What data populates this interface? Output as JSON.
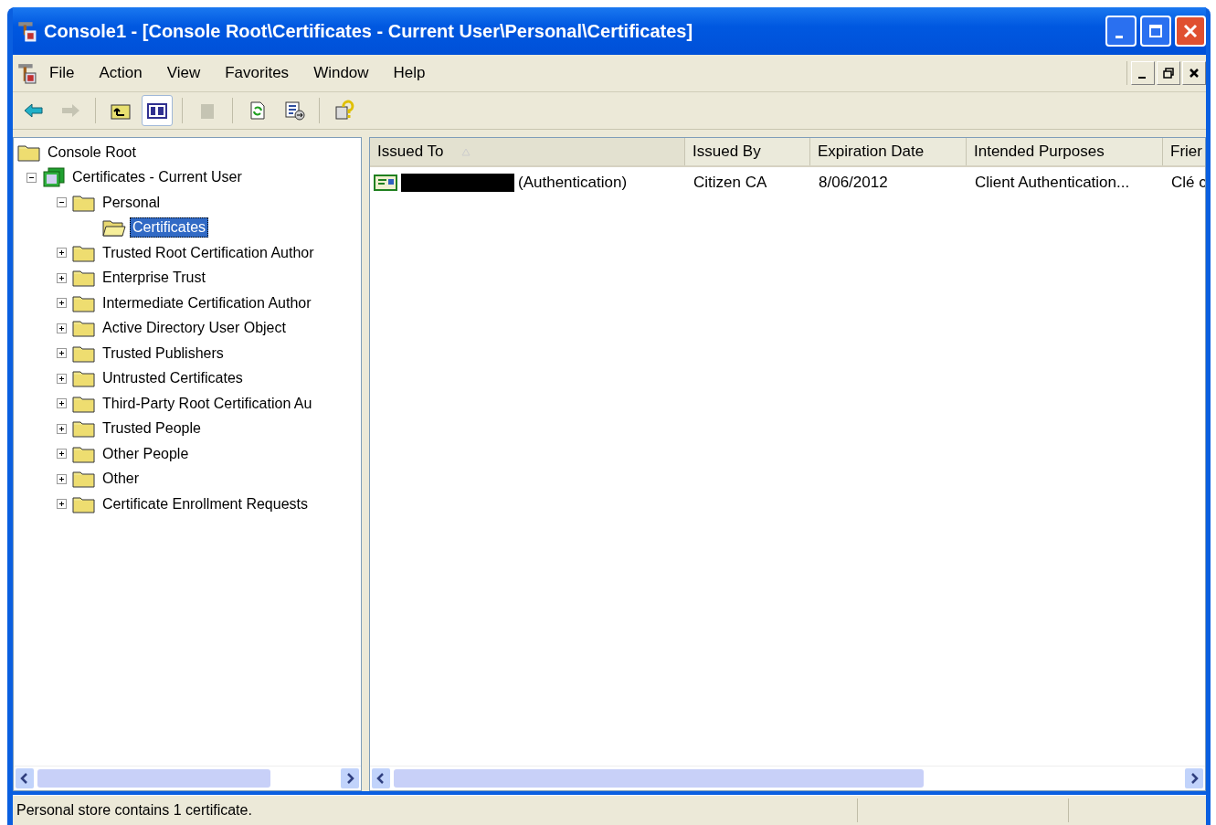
{
  "window": {
    "title": "Console1 - [Console Root\\Certificates - Current User\\Personal\\Certificates]"
  },
  "menu": [
    "File",
    "Action",
    "View",
    "Favorites",
    "Window",
    "Help"
  ],
  "toolbar": [
    {
      "kind": "back",
      "disabled": false,
      "pressed": false
    },
    {
      "kind": "forward",
      "disabled": true,
      "pressed": false
    },
    {
      "kind": "sep"
    },
    {
      "kind": "up",
      "disabled": false,
      "pressed": false
    },
    {
      "kind": "tree",
      "disabled": false,
      "pressed": true
    },
    {
      "kind": "sep"
    },
    {
      "kind": "delete",
      "disabled": true,
      "pressed": false
    },
    {
      "kind": "sep"
    },
    {
      "kind": "refresh",
      "disabled": false,
      "pressed": false
    },
    {
      "kind": "export",
      "disabled": false,
      "pressed": false
    },
    {
      "kind": "sep"
    },
    {
      "kind": "help",
      "disabled": false,
      "pressed": false
    }
  ],
  "tree": [
    {
      "label": "Console Root",
      "kind": "folder",
      "selected": false,
      "children": [
        {
          "label": "Certificates - Current User",
          "kind": "snapin",
          "expanded": true,
          "selected": false,
          "children": [
            {
              "label": "Personal",
              "kind": "folder",
              "expanded": true,
              "selected": false,
              "children": [
                {
                  "label": "Certificates",
                  "kind": "open",
                  "selected": true
                }
              ]
            },
            {
              "label": "Trusted Root Certification Author",
              "kind": "folder",
              "expanded": false,
              "selected": false
            },
            {
              "label": "Enterprise Trust",
              "kind": "folder",
              "expanded": false,
              "selected": false
            },
            {
              "label": "Intermediate Certification Author",
              "kind": "folder",
              "expanded": false,
              "selected": false
            },
            {
              "label": "Active Directory User Object",
              "kind": "folder",
              "expanded": false,
              "selected": false
            },
            {
              "label": "Trusted Publishers",
              "kind": "folder",
              "expanded": false,
              "selected": false
            },
            {
              "label": "Untrusted Certificates",
              "kind": "folder",
              "expanded": false,
              "selected": false
            },
            {
              "label": "Third-Party Root Certification Au",
              "kind": "folder",
              "expanded": false,
              "selected": false
            },
            {
              "label": "Trusted People",
              "kind": "folder",
              "expanded": false,
              "selected": false
            },
            {
              "label": "Other People",
              "kind": "folder",
              "expanded": false,
              "selected": false
            },
            {
              "label": "Other",
              "kind": "folder",
              "expanded": false,
              "selected": false
            },
            {
              "label": "Certificate Enrollment Requests",
              "kind": "folder",
              "expanded": false,
              "selected": false
            }
          ]
        }
      ]
    }
  ],
  "table": {
    "columns": [
      {
        "label": "Issued To",
        "sorted": true
      },
      {
        "label": "Issued By"
      },
      {
        "label": "Expiration Date"
      },
      {
        "label": "Intended Purposes"
      },
      {
        "label": "Frier"
      }
    ],
    "rows": [
      {
        "redacted": true,
        "cells": [
          "(Authentication)",
          "Citizen CA",
          "8/06/2012",
          "Client Authentication...",
          "Clé c"
        ]
      }
    ]
  },
  "status_bar": {
    "text": "Personal store contains 1 certificate."
  }
}
